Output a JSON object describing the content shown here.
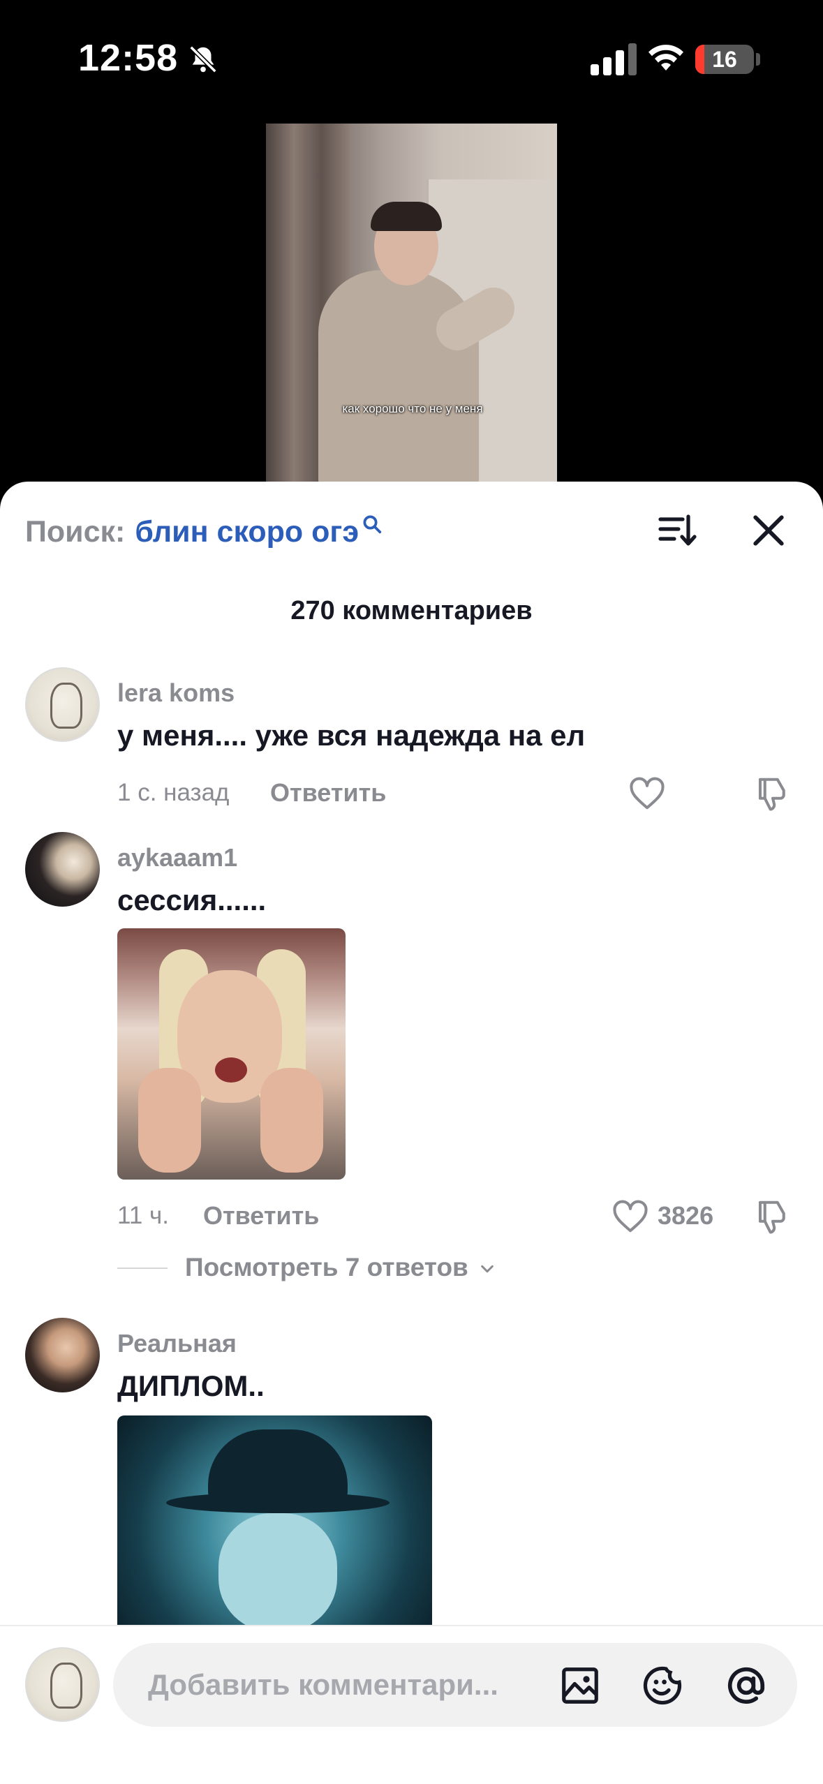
{
  "status_bar": {
    "time": "12:58",
    "battery": "16",
    "battery_level": 0.16
  },
  "video": {
    "caption": "как хорошо что не у меня"
  },
  "search": {
    "prefix": "Поиск:",
    "query": "блин скоро огэ"
  },
  "comments_count": "270 комментариев",
  "comments": [
    {
      "username": "lera koms",
      "text": "у меня.... уже вся надежда на ел",
      "time": "1 с. назад",
      "reply_label": "Ответить",
      "likes": ""
    },
    {
      "username": "aykaaam1",
      "text": "сессия......",
      "time": "11 ч.",
      "reply_label": "Ответить",
      "likes": "3826",
      "view_replies": "Посмотреть 7 ответов"
    },
    {
      "username": "Реальная",
      "text": "ДИПЛОМ.."
    }
  ],
  "composer": {
    "placeholder": "Добавить комментари..."
  },
  "icons": {
    "status": [
      "bell-off-icon",
      "signal-icon",
      "wifi-icon",
      "battery-icon"
    ],
    "header": [
      "search-icon",
      "sort-icon",
      "close-icon"
    ],
    "comment": [
      "heart-icon",
      "dislike-icon",
      "chevron-down-icon"
    ],
    "composer": [
      "image-icon",
      "emoji-icon",
      "mention-icon"
    ]
  }
}
